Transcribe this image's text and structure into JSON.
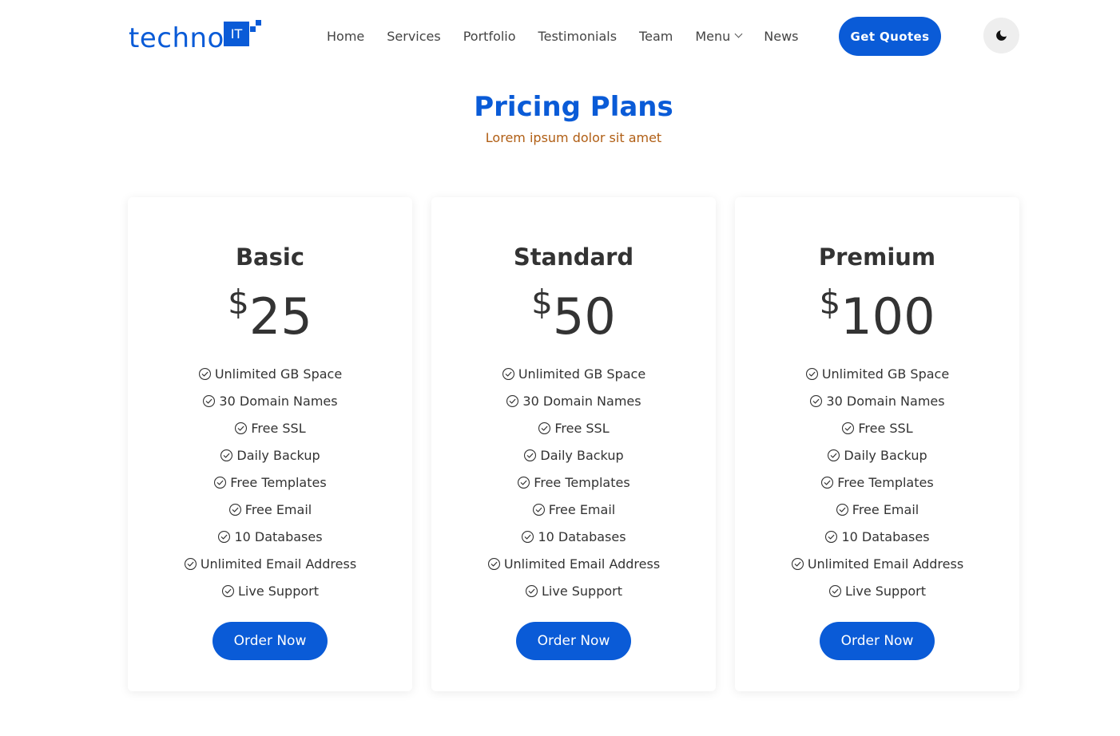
{
  "brand": {
    "name": "techno",
    "badge": "IT"
  },
  "nav": {
    "items": [
      {
        "label": "Home"
      },
      {
        "label": "Services"
      },
      {
        "label": "Portfolio"
      },
      {
        "label": "Testimonials"
      },
      {
        "label": "Team"
      },
      {
        "label": "Menu",
        "has_dropdown": true
      },
      {
        "label": "News"
      }
    ],
    "cta_label": "Get Quotes",
    "theme_toggle_icon": "moon-icon"
  },
  "section": {
    "title": "Pricing Plans",
    "subtitle": "Lorem ipsum dolor sit amet"
  },
  "plans": [
    {
      "name": "Basic",
      "currency": "$",
      "price": "25",
      "features": [
        "Unlimited GB Space",
        "30 Domain Names",
        "Free SSL",
        "Daily Backup",
        "Free Templates",
        "Free Email",
        "10 Databases",
        "Unlimited Email Address",
        "Live Support"
      ],
      "button_label": "Order Now"
    },
    {
      "name": "Standard",
      "currency": "$",
      "price": "50",
      "features": [
        "Unlimited GB Space",
        "30 Domain Names",
        "Free SSL",
        "Daily Backup",
        "Free Templates",
        "Free Email",
        "10 Databases",
        "Unlimited Email Address",
        "Live Support"
      ],
      "button_label": "Order Now"
    },
    {
      "name": "Premium",
      "currency": "$",
      "price": "100",
      "features": [
        "Unlimited GB Space",
        "30 Domain Names",
        "Free SSL",
        "Daily Backup",
        "Free Templates",
        "Free Email",
        "10 Databases",
        "Unlimited Email Address",
        "Live Support"
      ],
      "button_label": "Order Now"
    }
  ],
  "colors": {
    "primary": "#0a5bd7",
    "subtitle": "#b05e14",
    "text": "#333333",
    "toggle_bg": "#eeeeee"
  },
  "icons": {
    "feature_check": "check-circle-icon"
  }
}
